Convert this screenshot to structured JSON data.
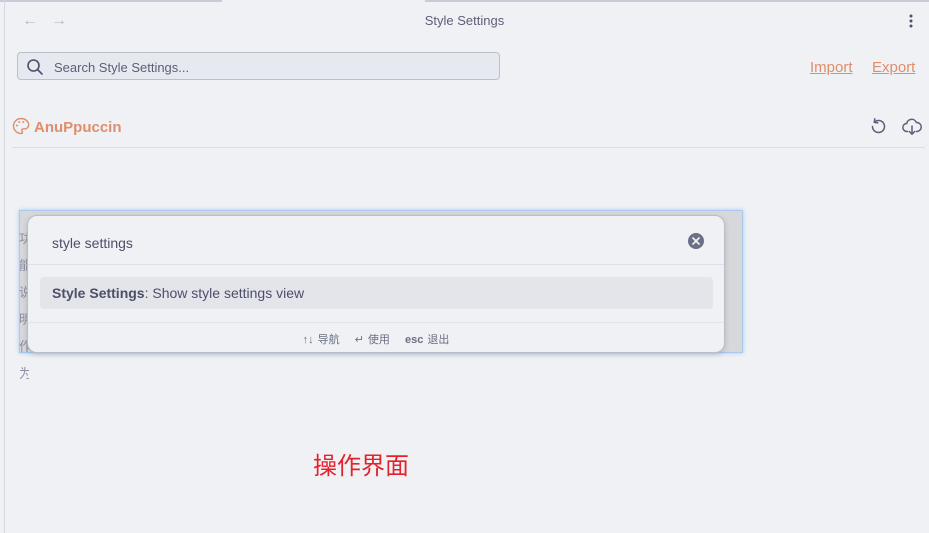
{
  "window": {
    "title": "Style Settings"
  },
  "nav": {
    "back_glyph": "←",
    "forward_glyph": "→"
  },
  "search": {
    "placeholder": "Search Style Settings...",
    "value": ""
  },
  "actions": {
    "import_label": "Import",
    "export_label": "Export"
  },
  "theme": {
    "name": "AnuPpuccin",
    "accent_color": "#df8e6b"
  },
  "background_text": "功能说明作为",
  "command_palette": {
    "query": "style settings",
    "suggestion": {
      "plugin": "Style Settings",
      "separator": ": ",
      "command": "Show style settings view"
    },
    "footer": {
      "navigate_key": "↑↓",
      "navigate_label": "导航",
      "use_key": "↵",
      "use_label": "使用",
      "exit_key": "esc",
      "exit_label": "退出"
    }
  },
  "annotation": {
    "text": "操作界面",
    "color": "#e5212b"
  },
  "icons": [
    "arrow-left-icon",
    "arrow-right-icon",
    "more-vertical-icon",
    "search-icon",
    "palette-icon",
    "reset-icon",
    "download-icon",
    "clear-icon"
  ]
}
